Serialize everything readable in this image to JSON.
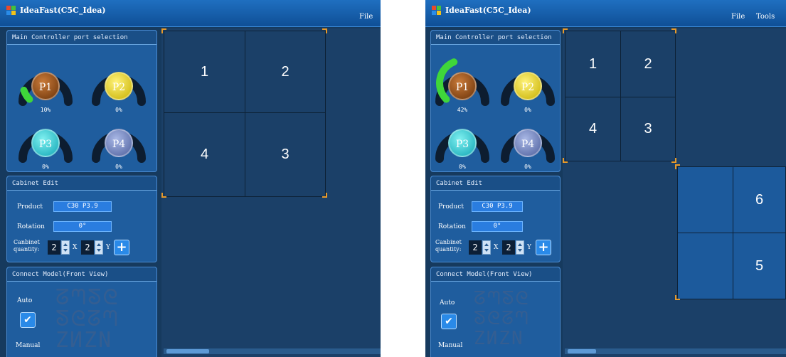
{
  "windows": [
    {
      "title": "IdeaFast(C5C_Idea)",
      "menu": [
        "File"
      ],
      "port_panel": {
        "title": "Main Controller port selection",
        "ports": [
          {
            "label": "P1",
            "percent": "10%",
            "load": 0.1
          },
          {
            "label": "P2",
            "percent": "0%",
            "load": 0
          },
          {
            "label": "P3",
            "percent": "0%",
            "load": 0
          },
          {
            "label": "P4",
            "percent": "0%",
            "load": 0
          }
        ]
      },
      "cabinet_panel": {
        "title": "Cabinet Edit",
        "product_label": "Product",
        "product_value": "C30 P3.9",
        "rotation_label": "Rotation",
        "rotation_value": "0°",
        "quantity_label_1": "Canbinet",
        "quantity_label_2": "quantity:",
        "x_value": "2",
        "x_label": "X",
        "y_value": "2",
        "y_label": "Y"
      },
      "connect_panel": {
        "title": "Connect Model(Front View)",
        "auto_label": "Auto",
        "manual_label": "Manual",
        "auto_checked": true
      },
      "cells": [
        "1",
        "2",
        "4",
        "3"
      ]
    },
    {
      "title": "IdeaFast(C5C_Idea)",
      "menu": [
        "File",
        "Tools"
      ],
      "port_panel": {
        "title": "Main Controller port selection",
        "ports": [
          {
            "label": "P1",
            "percent": "42%",
            "load": 0.42
          },
          {
            "label": "P2",
            "percent": "0%",
            "load": 0
          },
          {
            "label": "P3",
            "percent": "0%",
            "load": 0
          },
          {
            "label": "P4",
            "percent": "0%",
            "load": 0
          }
        ]
      },
      "cabinet_panel": {
        "title": "Cabinet Edit",
        "product_label": "Product",
        "product_value": "C30 P3.9",
        "rotation_label": "Rotation",
        "rotation_value": "0°",
        "quantity_label_1": "Canbinet",
        "quantity_label_2": "quantity:",
        "x_value": "2",
        "x_label": "X",
        "y_value": "2",
        "y_label": "Y"
      },
      "connect_panel": {
        "title": "Connect Model(Front View)",
        "auto_label": "Auto",
        "manual_label": "Manual",
        "auto_checked": true
      },
      "cells_group_a": [
        "1",
        "2",
        "4",
        "3"
      ],
      "cells_group_b": [
        "6",
        "5"
      ]
    }
  ],
  "colors": {
    "accent": "#2a8ae8",
    "gauge_fill": "#3fd63a",
    "selection_corner": "#e89a2a",
    "background": "#163a5e"
  }
}
